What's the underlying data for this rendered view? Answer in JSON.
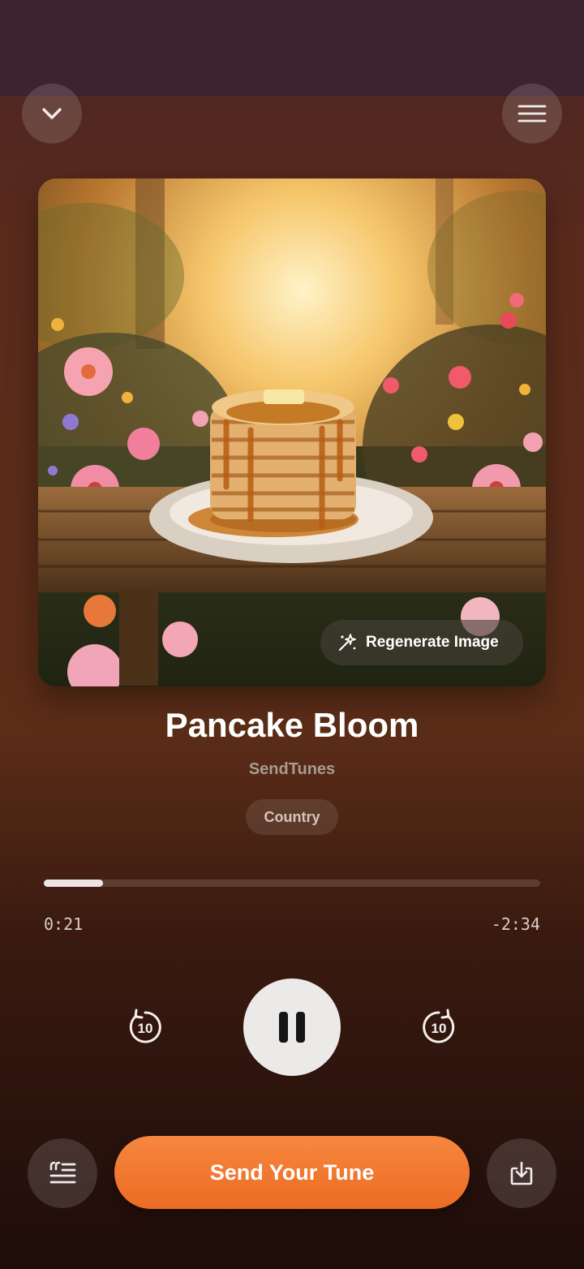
{
  "header": {
    "collapse_icon": "chevron-down-icon",
    "menu_icon": "hamburger-menu-icon"
  },
  "artwork": {
    "regenerate_label": "Regenerate Image",
    "regenerate_icon": "sparkle-wand-icon"
  },
  "track": {
    "title": "Pancake Bloom",
    "artist": "SendTunes",
    "genre": "Country"
  },
  "playback": {
    "elapsed": "0:21",
    "remaining": "-2:34",
    "progress_fraction": 0.12,
    "skip_back_label": "10",
    "skip_forward_label": "10",
    "state": "playing",
    "play_pause_icon": "pause-icon"
  },
  "actions": {
    "lyrics_icon": "lyrics-icon",
    "send_label": "Send Your Tune",
    "download_icon": "download-icon"
  },
  "colors": {
    "accent": "#F07A33",
    "background_top": "#5A2B1C",
    "background_bottom": "#1E0D0A"
  }
}
